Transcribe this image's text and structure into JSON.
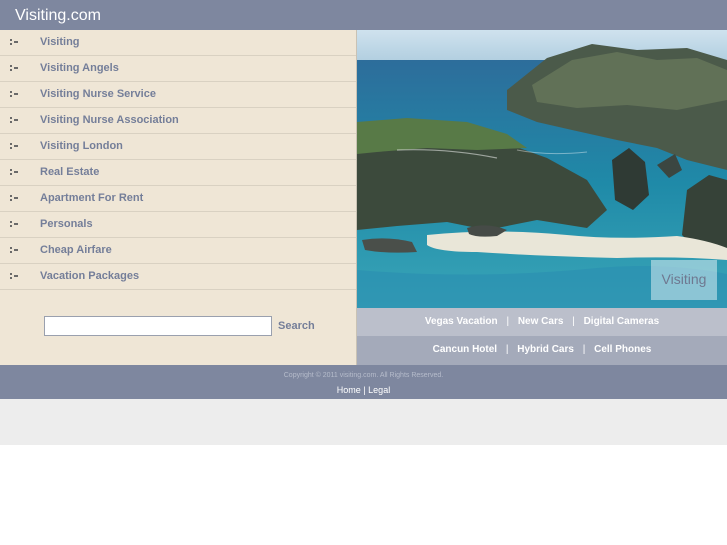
{
  "header": {
    "title": "Visiting.com"
  },
  "sidebar": {
    "items": [
      {
        "label": "Visiting"
      },
      {
        "label": "Visiting Angels"
      },
      {
        "label": "Visiting Nurse Service"
      },
      {
        "label": "Visiting Nurse Association"
      },
      {
        "label": "Visiting London"
      },
      {
        "label": "Real Estate"
      },
      {
        "label": "Apartment For Rent"
      },
      {
        "label": "Personals"
      },
      {
        "label": "Cheap Airfare"
      },
      {
        "label": "Vacation Packages"
      }
    ]
  },
  "search": {
    "value": "",
    "button_label": "Search"
  },
  "hero": {
    "badge_label": "Visiting",
    "image": "coastal-cliffs-photo"
  },
  "links": {
    "row1": [
      "Vegas Vacation",
      "New Cars",
      "Digital Cameras"
    ],
    "row2": [
      "Cancun Hotel",
      "Hybrid Cars",
      "Cell Phones"
    ],
    "separator": "|"
  },
  "footer": {
    "copyright": "Copyright © 2011 visiting.com. All Rights Reserved.",
    "home_label": "Home",
    "separator": "|",
    "legal_label": "Legal"
  },
  "colors": {
    "header": "#7e879f",
    "sidebar_bg": "#efe6d6",
    "link_text": "#747e99",
    "links_row1": "#bbbfcb",
    "links_row2": "#a4aaba"
  }
}
